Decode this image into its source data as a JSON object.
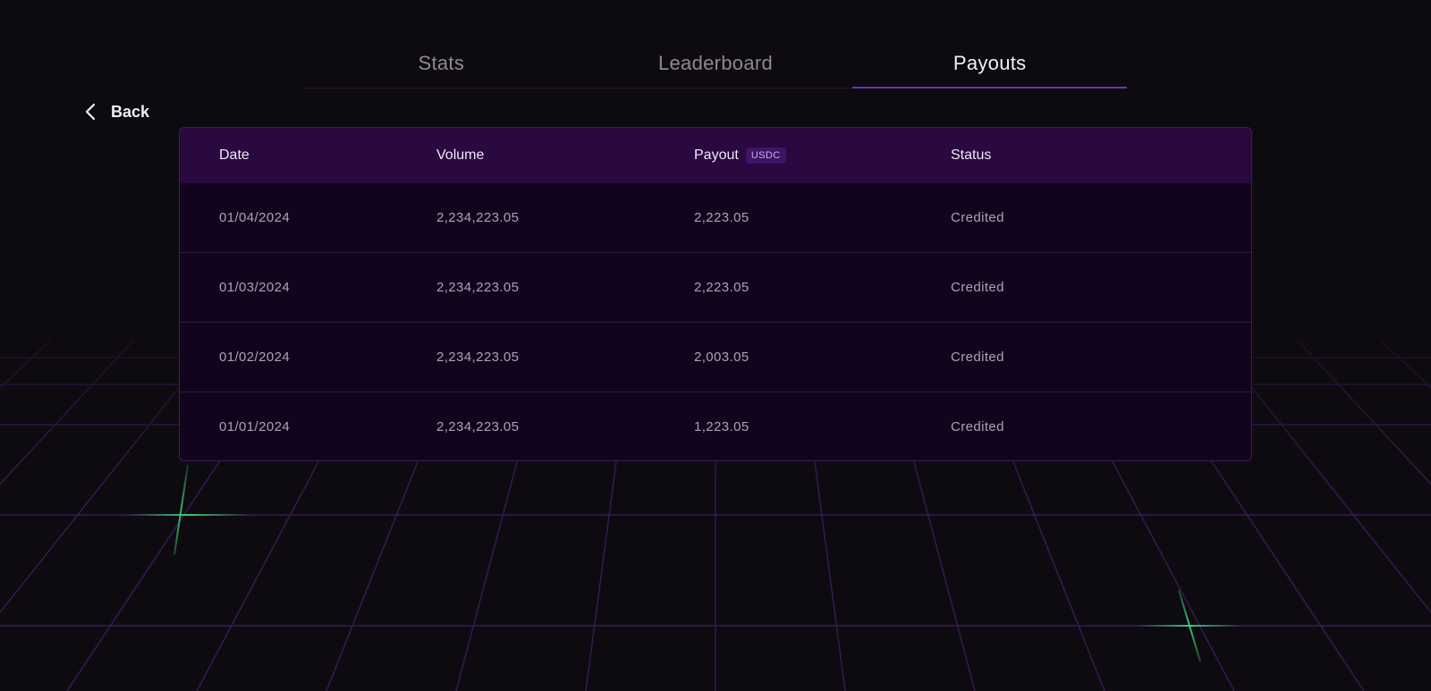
{
  "tabs": [
    {
      "label": "Stats",
      "active": false
    },
    {
      "label": "Leaderboard",
      "active": false
    },
    {
      "label": "Payouts",
      "active": true
    }
  ],
  "back": {
    "label": "Back",
    "icon": "chevron-left-icon"
  },
  "table": {
    "headers": {
      "date": "Date",
      "volume": "Volume",
      "payout": "Payout",
      "payout_badge": "USDC",
      "status": "Status"
    },
    "rows": [
      {
        "date": "01/04/2024",
        "volume": "2,234,223.05",
        "payout": "2,223.05",
        "status": "Credited"
      },
      {
        "date": "01/03/2024",
        "volume": "2,234,223.05",
        "payout": "2,223.05",
        "status": "Credited"
      },
      {
        "date": "01/02/2024",
        "volume": "2,234,223.05",
        "payout": "2,003.05",
        "status": "Credited"
      },
      {
        "date": "01/01/2024",
        "volume": "2,234,223.05",
        "payout": "1,223.05",
        "status": "Credited"
      }
    ]
  },
  "colors": {
    "background": "#0d0b10",
    "accent": "#6a36b8",
    "header_bg": "#2a0840",
    "grid_line": "#3a1a55",
    "grid_glow": "#3ddc84"
  }
}
